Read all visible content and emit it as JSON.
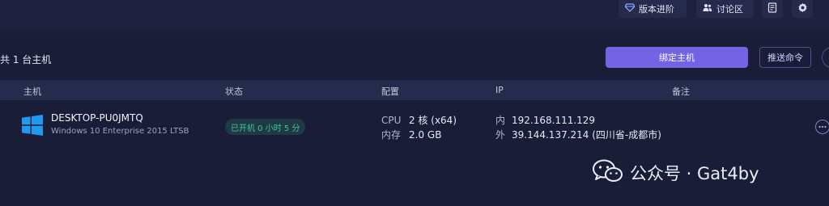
{
  "topbar": {
    "upgrade_label": "版本进阶",
    "discuss_label": "讨论区"
  },
  "toolbar": {
    "host_count": "共 1 台主机",
    "bind_label": "绑定主机",
    "push_label": "推送命令"
  },
  "table": {
    "columns": [
      "主机",
      "状态",
      "配置",
      "IP",
      "备注"
    ],
    "rows": [
      {
        "name": "DESKTOP-PU0JMTQ",
        "os": "Windows 10 Enterprise 2015 LTSB",
        "status": "已开机 0 小时 5 分",
        "cpu_label": "CPU",
        "cpu_value": "2 核 (x64)",
        "mem_label": "内存",
        "mem_value": "2.0 GB",
        "ip_inner_label": "内",
        "ip_inner": "192.168.111.129",
        "ip_outer_label": "外",
        "ip_outer": "39.144.137.214 (四川省-成都市)",
        "note": ""
      }
    ]
  },
  "watermark": {
    "text": "公众号 · Gat4by"
  },
  "icons": {
    "upgrade": "diamond-icon",
    "discuss": "users-icon",
    "docs": "document-icon",
    "settings": "gear-icon",
    "host_os": "windows-icon",
    "more": "ellipsis-icon",
    "watermark": "wechat-icon"
  },
  "colors": {
    "primary": "#7563e6",
    "status_green": "#3ec59a",
    "background": "#1b1f3a"
  }
}
